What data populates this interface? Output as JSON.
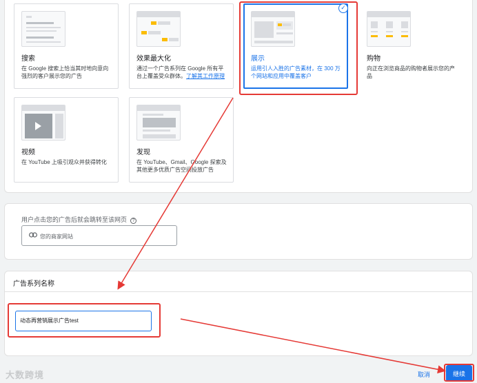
{
  "goals": [
    {
      "title": "搜索",
      "desc": "在 Google 搜索上恰当其时地向意向强烈的客户展示您的广告"
    },
    {
      "title": "效果最大化",
      "desc": "通过一个广告系列在 Google 所有平台上覆盖受众群体。",
      "link": "了解其工作原理"
    },
    {
      "title": "展示",
      "desc": "运用引人入胜的广告素材，在 300 万个网站和应用中覆盖客户",
      "selected_mark": "✓"
    },
    {
      "title": "购物",
      "desc": "向正在浏览商品的购物者展示您的产品"
    },
    {
      "title": "视频",
      "desc": "在 YouTube 上吸引观众并获得转化"
    },
    {
      "title": "发现",
      "desc": "在 YouTube、Gmail、Google 探索及其他更多优质广告空间投放广告"
    }
  ],
  "url_section": {
    "label": "用户点击您的广告后就会跳转至该网页",
    "help_glyph": "?",
    "placeholder": "您的商家网站"
  },
  "campaign_name": {
    "title": "广告系列名称",
    "value": "动态再营销展示广告test"
  },
  "footer": {
    "cancel": "取消",
    "continue": "继续",
    "watermark": "大数跨境"
  },
  "colors": {
    "accent": "#1a73e8",
    "annotation": "#e53935"
  }
}
